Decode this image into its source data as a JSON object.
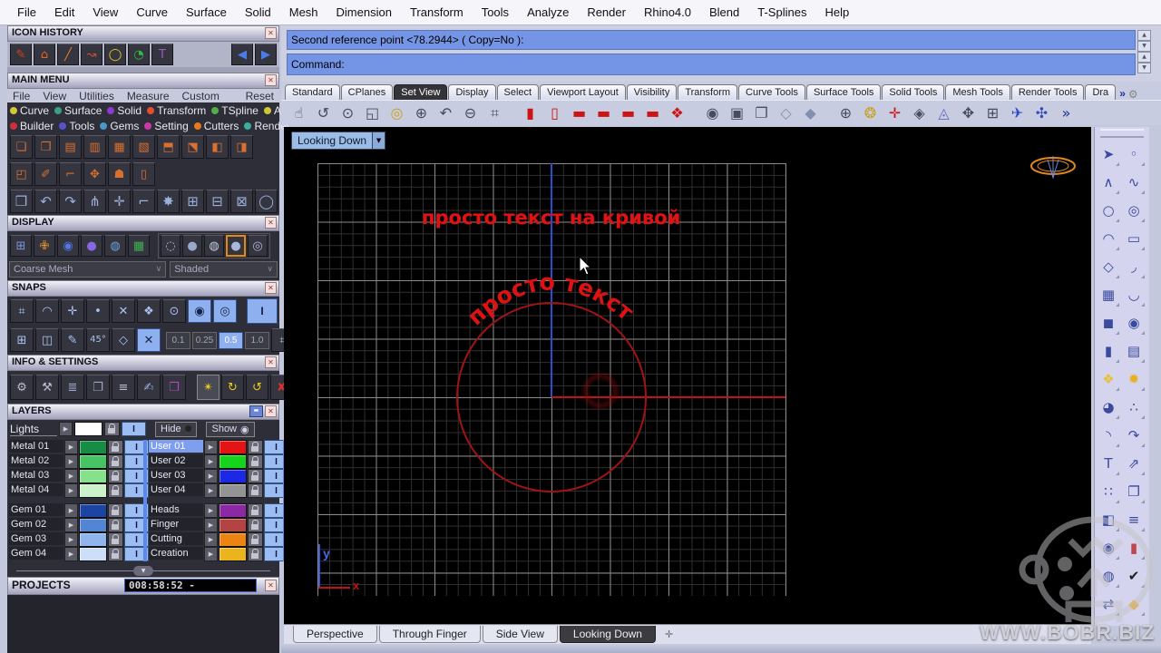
{
  "window": {
    "close_glyph": "✕",
    "min_glyph": "▬",
    "chevron": "»",
    "gear": "⚙",
    "dropdown_arrow": "▼",
    "up": "▲",
    "down": "▼",
    "tri_right": "▶",
    "left_arrow": "◀",
    "right_arrow": "▶",
    "plus": "✛",
    "select_arrow": "∨",
    "collapse_glyph": "▼"
  },
  "menu_bar": {
    "items": [
      "File",
      "Edit",
      "View",
      "Curve",
      "Surface",
      "Solid",
      "Mesh",
      "Dimension",
      "Transform",
      "Tools",
      "Analyze",
      "Render",
      "Rhino4.0",
      "Blend",
      "T-Splines",
      "Help"
    ]
  },
  "command_area": {
    "line1": "Second reference point <78.2944> ( Copy=No ):",
    "line2": "Command:"
  },
  "toolbar_tabs": {
    "tabs": [
      {
        "label": "Standard"
      },
      {
        "label": "CPlanes"
      },
      {
        "label": "Set View",
        "active": true
      },
      {
        "label": "Display"
      },
      {
        "label": "Select"
      },
      {
        "label": "Viewport Layout"
      },
      {
        "label": "Visibility"
      },
      {
        "label": "Transform"
      },
      {
        "label": "Curve Tools"
      },
      {
        "label": "Surface Tools"
      },
      {
        "label": "Solid Tools"
      },
      {
        "label": "Mesh Tools"
      },
      {
        "label": "Render Tools"
      },
      {
        "label": "Dra"
      }
    ]
  },
  "top_toolbar": {
    "icons": [
      {
        "n": "pan-icon",
        "g": "☝",
        "c": "#4a4a62"
      },
      {
        "n": "rotate-view-icon",
        "g": "↺",
        "c": "#4a4a62"
      },
      {
        "n": "zoom-dynamic-icon",
        "g": "⊙",
        "c": "#4a4a62"
      },
      {
        "n": "zoom-window-icon",
        "g": "◱",
        "c": "#4a4a62"
      },
      {
        "n": "zoom-selected-icon",
        "g": "◎",
        "c": "#c8a020"
      },
      {
        "n": "zoom-target-icon",
        "g": "⊕",
        "c": "#4a4a62"
      },
      {
        "n": "undo-view-icon",
        "g": "↶",
        "c": "#4a4a62"
      },
      {
        "n": "zoom-out-icon",
        "g": "⊖",
        "c": "#4a4a62"
      },
      {
        "n": "zoom-1to1-icon",
        "g": "⌗",
        "c": "#4a4a62",
        "sep_after": true
      },
      {
        "n": "view-preset-1-icon",
        "g": "▮",
        "c": "#cc1414"
      },
      {
        "n": "view-preset-2-icon",
        "g": "▯",
        "c": "#cc1414"
      },
      {
        "n": "view-front-icon",
        "g": "▬",
        "c": "#cc1414"
      },
      {
        "n": "view-right-icon",
        "g": "▬",
        "c": "#cc1414"
      },
      {
        "n": "view-top-icon",
        "g": "▬",
        "c": "#cc1414"
      },
      {
        "n": "view-back-icon",
        "g": "▬",
        "c": "#cc1414"
      },
      {
        "n": "view-perspective-icon",
        "g": "❖",
        "c": "#cc1414",
        "sep_after": true
      },
      {
        "n": "camera-icon",
        "g": "◉",
        "c": "#4a4a62"
      },
      {
        "n": "save-view-icon",
        "g": "▣",
        "c": "#4a4a62"
      },
      {
        "n": "named-views-icon",
        "g": "❐",
        "c": "#4a4a62"
      },
      {
        "n": "cplane-light-icon",
        "g": "◇",
        "c": "#8090b0"
      },
      {
        "n": "cplane-dark-icon",
        "g": "◆",
        "c": "#8090b0",
        "sep_after": true
      },
      {
        "n": "set-cplane-icon",
        "g": "⊕",
        "c": "#4a4a62"
      },
      {
        "n": "cplane-origin-icon",
        "g": "❂",
        "c": "#c8a020"
      },
      {
        "n": "cplane-vertical-icon",
        "g": "✛",
        "c": "#cc1414"
      },
      {
        "n": "cplane-object-icon",
        "g": "◈",
        "c": "#4a4a62"
      },
      {
        "n": "cplane-world-icon",
        "g": "◬",
        "c": "#6070c0"
      },
      {
        "n": "gumball-icon",
        "g": "✥",
        "c": "#4a4a62"
      },
      {
        "n": "grid-options-icon",
        "g": "⊞",
        "c": "#4a4a62"
      },
      {
        "n": "plane-view-icon",
        "g": "✈",
        "c": "#3048c0"
      },
      {
        "n": "heli-view-icon",
        "g": "✣",
        "c": "#3048c0"
      },
      {
        "n": "more-tools-chevron",
        "g": "»",
        "c": "#203090"
      }
    ]
  },
  "panels": {
    "icon_history": {
      "title": "ICON HISTORY",
      "icons": [
        {
          "n": "sketch-icon",
          "g": "✎",
          "c": "#d84020"
        },
        {
          "n": "roof-icon",
          "g": "⌂",
          "c": "#e06820"
        },
        {
          "n": "line-icon",
          "g": "╱",
          "c": "#e08030"
        },
        {
          "n": "curve-arrow-icon",
          "g": "↝",
          "c": "#d05030"
        },
        {
          "n": "circle-tool-icon",
          "g": "◯",
          "c": "#e8d020"
        },
        {
          "n": "clock-icon",
          "g": "◔",
          "c": "#30c040"
        },
        {
          "n": "text-tool-icon",
          "g": "T",
          "c": "#9a58c8"
        }
      ]
    },
    "main_menu": {
      "title": "MAIN MENU",
      "items": [
        "File",
        "View",
        "Utilities",
        "Measure",
        "Custom",
        "Reset"
      ],
      "cat_row1": [
        {
          "label": "Curve",
          "c": "#d4c838"
        },
        {
          "label": "Surface",
          "c": "#38a080"
        },
        {
          "label": "Solid",
          "c": "#9038d0"
        },
        {
          "label": "Transform",
          "c": "#e05030"
        },
        {
          "label": "TSpline",
          "c": "#50b048"
        },
        {
          "label": "Art",
          "c": "#ccc838"
        }
      ],
      "cat_row2": [
        {
          "label": "Builder",
          "c": "#cc3038"
        },
        {
          "label": "Tools",
          "c": "#5850d0"
        },
        {
          "label": "Gems",
          "c": "#4898c8"
        },
        {
          "label": "Setting",
          "c": "#cc38a8"
        },
        {
          "label": "Cutters",
          "c": "#e87820"
        },
        {
          "label": "Render",
          "c": "#38b0a0"
        }
      ],
      "grid_row1": [
        {
          "n": "tool-icon",
          "g": "❏"
        },
        {
          "n": "tool-icon",
          "g": "❐"
        },
        {
          "n": "tool-icon",
          "g": "▤"
        },
        {
          "n": "tool-icon",
          "g": "▥"
        },
        {
          "n": "tool-icon",
          "g": "▦"
        },
        {
          "n": "tool-icon",
          "g": "▧"
        },
        {
          "n": "tool-icon",
          "g": "⬒"
        },
        {
          "n": "tool-icon",
          "g": "⬔"
        },
        {
          "n": "tool-icon",
          "g": "◧"
        },
        {
          "n": "tool-icon",
          "g": "◨"
        }
      ],
      "grid_row2": [
        {
          "n": "tool-icon",
          "g": "◰"
        },
        {
          "n": "tool-icon",
          "g": "✐"
        },
        {
          "n": "tool-icon",
          "g": "⌐"
        },
        {
          "n": "tool-icon",
          "g": "✥"
        },
        {
          "n": "tool-icon",
          "g": "☗"
        },
        {
          "n": "tool-icon",
          "g": "▯"
        }
      ],
      "grid_row3": [
        {
          "n": "tool-icon",
          "g": "❒"
        },
        {
          "n": "tool-icon",
          "g": "↶"
        },
        {
          "n": "tool-icon",
          "g": "↷"
        },
        {
          "n": "tool-icon",
          "g": "⋔"
        },
        {
          "n": "tool-icon",
          "g": "✛"
        },
        {
          "n": "tool-icon",
          "g": "⌐"
        },
        {
          "n": "tool-icon",
          "g": "✸"
        },
        {
          "n": "tool-icon",
          "g": "⊞"
        },
        {
          "n": "tool-icon",
          "g": "⊟"
        },
        {
          "n": "tool-icon",
          "g": "⊠"
        },
        {
          "n": "tool-icon",
          "g": "◯"
        }
      ]
    },
    "display": {
      "title": "DISPLAY",
      "mode_icons": [
        {
          "n": "grid-axes-icon",
          "g": "⊞",
          "c": "#7898d8"
        },
        {
          "n": "figure-icon",
          "g": "✙",
          "c": "#e09030"
        },
        {
          "n": "sphere-blue-icon",
          "g": "◉",
          "c": "#5078e0"
        },
        {
          "n": "sphere-purple-icon",
          "g": "●",
          "c": "#8868e0"
        },
        {
          "n": "earth-icon",
          "g": "◍",
          "c": "#70a0d8"
        },
        {
          "n": "layout-icon",
          "g": "▦",
          "c": "#40b050"
        }
      ],
      "shade_icons": [
        {
          "n": "wireframe-mode-icon",
          "g": "◌",
          "c": "#b0c0e0"
        },
        {
          "n": "flat-mode-icon",
          "g": "●",
          "c": "#98a8c8"
        },
        {
          "n": "ghost-mode-icon",
          "g": "◍",
          "c": "#c0cce4"
        },
        {
          "n": "shaded-mode-icon",
          "g": "●",
          "c": "#aab8dc",
          "active": true
        },
        {
          "n": "render-mode-icon",
          "g": "◎",
          "c": "#aab8dc"
        }
      ],
      "mesh_dropdown": "Coarse Mesh",
      "shade_dropdown": "Shaded"
    },
    "snaps": {
      "title": "SNAPS",
      "row1": [
        {
          "n": "grid-snap-icon",
          "g": "⌗"
        },
        {
          "n": "near-snap-icon",
          "g": "◠"
        },
        {
          "n": "point-snap-icon",
          "g": "✛"
        },
        {
          "n": "vertex-snap-icon",
          "g": "•"
        },
        {
          "n": "intersection-snap-icon",
          "g": "✕"
        },
        {
          "n": "quad-snap-icon",
          "g": "❖"
        },
        {
          "n": "center-snap-icon",
          "g": "⊙"
        },
        {
          "n": "end-snap-icon",
          "g": "◉",
          "active": true
        },
        {
          "n": "mid-snap-icon",
          "g": "◎",
          "active": true
        }
      ],
      "planar_label": "I",
      "row2a": [
        {
          "n": "grid-toggle-icon",
          "g": "⊞"
        },
        {
          "n": "iso-snap-icon",
          "g": "◫"
        },
        {
          "n": "line-snap-icon",
          "g": "✎"
        }
      ],
      "angle_label": "45°",
      "row2b": [
        {
          "n": "cplane-snap-icon",
          "g": "◇"
        },
        {
          "n": "smarttrack-icon",
          "g": "✕",
          "active": true
        }
      ],
      "increments": [
        {
          "v": "0.1"
        },
        {
          "v": "0.25"
        },
        {
          "v": "0.5",
          "active": true
        },
        {
          "v": "1.0"
        }
      ],
      "row2c": [
        {
          "n": "grid-settings-icon",
          "g": "⌗"
        }
      ]
    },
    "info": {
      "title": "INFO & SETTINGS",
      "icons": [
        {
          "n": "settings-gears-icon",
          "g": "⚙",
          "c": "#b8bcd0"
        },
        {
          "n": "wrench-icon",
          "g": "⚒",
          "c": "#b8bcd0"
        },
        {
          "n": "stack-icon",
          "g": "≣",
          "c": "#9aa8c8"
        },
        {
          "n": "copy-box-icon",
          "g": "❐",
          "c": "#9aa8c8"
        },
        {
          "n": "script-icon",
          "g": "≡",
          "c": "#b8bcd0"
        },
        {
          "n": "notes-icon",
          "g": "✍",
          "c": "#9ab0dc"
        },
        {
          "n": "package-icon",
          "g": "❒",
          "c": "#b048c0"
        }
      ],
      "history_icons": [
        {
          "n": "record-history-icon",
          "g": "✴",
          "c": "#e8c820",
          "active": true
        },
        {
          "n": "history-loop-icon",
          "g": "↻",
          "c": "#e8c820"
        },
        {
          "n": "history-replay-icon",
          "g": "↺",
          "c": "#e8c820"
        },
        {
          "n": "purge-history-icon",
          "g": "✘",
          "c": "#e03030"
        }
      ]
    },
    "layers": {
      "title": "LAYERS",
      "lights_label": "Lights",
      "hide_label": "Hide",
      "show_label": "Show",
      "hide_glyph": "●",
      "show_glyph": "◉",
      "i_label": "I",
      "left": [
        {
          "name": "Metal 01",
          "c": "#168c44"
        },
        {
          "name": "Metal 02",
          "c": "#46c464"
        },
        {
          "name": "Metal 03",
          "c": "#86e08c"
        },
        {
          "name": "Metal 04",
          "c": "#ccf2cc"
        },
        {
          "name": "Gem 01",
          "c": "#1c44a4",
          "gap_before": true
        },
        {
          "name": "Gem 02",
          "c": "#5484d4"
        },
        {
          "name": "Gem 03",
          "c": "#90b4ec"
        },
        {
          "name": "Gem 04",
          "c": "#ccdef8"
        }
      ],
      "right": [
        {
          "name": "User 01",
          "c": "#e41414",
          "selected": true
        },
        {
          "name": "User 02",
          "c": "#16d41c"
        },
        {
          "name": "User 03",
          "c": "#1c28e4"
        },
        {
          "name": "User 04",
          "c": "#949494"
        },
        {
          "name": "Heads",
          "c": "#8c28a4",
          "gap_before": true
        },
        {
          "name": "Finger",
          "c": "#b44444"
        },
        {
          "name": "Cutting",
          "c": "#ec8414"
        },
        {
          "name": "Creation",
          "c": "#ecb41c"
        }
      ]
    },
    "projects": {
      "title": "PROJECTS",
      "timer": "008:58:52 -"
    }
  },
  "viewport": {
    "title": "Looking Down",
    "straight_text": "просто текст на кривой",
    "arc_text": "просто текст",
    "axis_x": "x",
    "axis_y": "y"
  },
  "viewport_tabs": {
    "tabs": [
      {
        "label": "Perspective"
      },
      {
        "label": "Through Finger"
      },
      {
        "label": "Side View"
      },
      {
        "label": "Looking Down",
        "active": true
      }
    ]
  },
  "right_toolbar": {
    "icons": [
      {
        "n": "select-arrow-icon",
        "g": "➤"
      },
      {
        "n": "single-point-icon",
        "g": "◦"
      },
      {
        "n": "polyline-icon",
        "g": "∧"
      },
      {
        "n": "control-point-curve-icon",
        "g": "∿"
      },
      {
        "n": "circle-icon",
        "g": "○"
      },
      {
        "n": "ellipse-icon",
        "g": "◎"
      },
      {
        "n": "arc-icon",
        "g": "◠"
      },
      {
        "n": "rectangle-icon",
        "g": "▭"
      },
      {
        "n": "polygon-icon",
        "g": "◇"
      },
      {
        "n": "curve-blend-icon",
        "g": "◞"
      },
      {
        "n": "surface-patch-icon",
        "g": "▦"
      },
      {
        "n": "bent-surface-icon",
        "g": "◡"
      },
      {
        "n": "box-icon",
        "g": "◼"
      },
      {
        "n": "spheres-icon",
        "g": "◉"
      },
      {
        "n": "cylinder-icon",
        "g": "▮"
      },
      {
        "n": "mesh-surface-icon",
        "g": "▤"
      },
      {
        "n": "puzzle-icon",
        "g": "❖",
        "c": "#e8c030"
      },
      {
        "n": "explode-icon",
        "g": "✹",
        "c": "#e8b020"
      },
      {
        "n": "boolean-union-icon",
        "g": "◕"
      },
      {
        "n": "point-cloud-icon",
        "g": "∴"
      },
      {
        "n": "fillet-curve-icon",
        "g": "◝"
      },
      {
        "n": "blend-curve-icon",
        "g": "↷"
      },
      {
        "n": "text-object-icon",
        "g": "T"
      },
      {
        "n": "scale-icon",
        "g": "⇗"
      },
      {
        "n": "array-icon",
        "g": "∷"
      },
      {
        "n": "duplicate-icon",
        "g": "❐"
      },
      {
        "n": "solid-union-icon",
        "g": "◧"
      },
      {
        "n": "hatch-icon",
        "g": "≡"
      },
      {
        "n": "sphere-pair-icon",
        "g": "◉"
      },
      {
        "n": "pipe-icon",
        "g": "▮",
        "c": "#c04848"
      },
      {
        "n": "boolean-diff-icon",
        "g": "◍"
      },
      {
        "n": "check-icon",
        "g": "✔",
        "c": "#202020"
      },
      {
        "n": "flip-icon",
        "g": "⇄"
      },
      {
        "n": "gem-icon",
        "g": "◆",
        "c": "#e8a830"
      }
    ]
  },
  "watermark": {
    "text": "WWW.BOBR.BIZ"
  }
}
